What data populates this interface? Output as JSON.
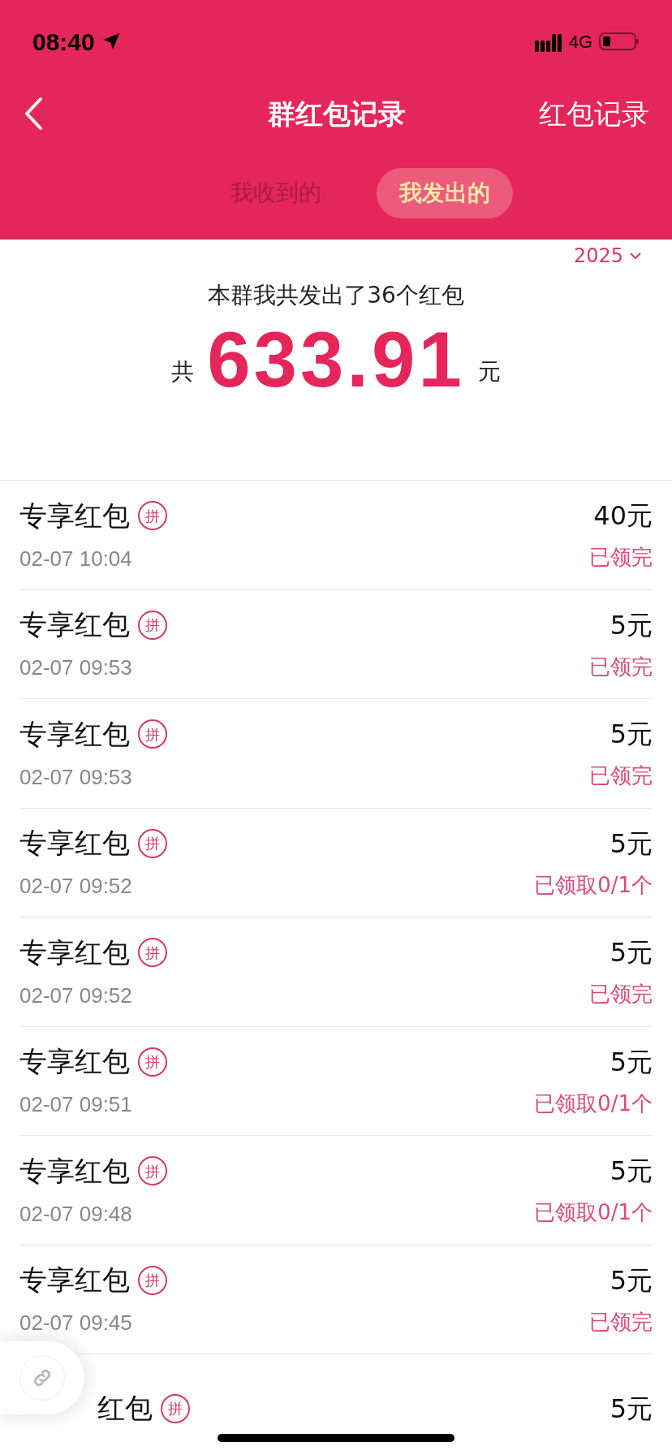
{
  "status_bar": {
    "time": "08:40",
    "network": "4G"
  },
  "nav": {
    "title": "群红包记录",
    "action": "红包记录"
  },
  "tabs": [
    {
      "label": "我收到的",
      "selected": false
    },
    {
      "label": "我发出的",
      "selected": true
    }
  ],
  "year": "2025",
  "summary": {
    "text": "本群我共发出了36个红包",
    "prefix": "共",
    "amount": "633.91",
    "unit": "元"
  },
  "records": [
    {
      "title": "专享红包",
      "badge": "拼",
      "time": "02-07 10:04",
      "amount": "40元",
      "status": "已领完"
    },
    {
      "title": "专享红包",
      "badge": "拼",
      "time": "02-07 09:53",
      "amount": "5元",
      "status": "已领完"
    },
    {
      "title": "专享红包",
      "badge": "拼",
      "time": "02-07 09:53",
      "amount": "5元",
      "status": "已领完"
    },
    {
      "title": "专享红包",
      "badge": "拼",
      "time": "02-07 09:52",
      "amount": "5元",
      "status": "已领取0/1个"
    },
    {
      "title": "专享红包",
      "badge": "拼",
      "time": "02-07 09:52",
      "amount": "5元",
      "status": "已领完"
    },
    {
      "title": "专享红包",
      "badge": "拼",
      "time": "02-07 09:51",
      "amount": "5元",
      "status": "已领取0/1个"
    },
    {
      "title": "专享红包",
      "badge": "拼",
      "time": "02-07 09:48",
      "amount": "5元",
      "status": "已领取0/1个"
    },
    {
      "title": "专享红包",
      "badge": "拼",
      "time": "02-07 09:45",
      "amount": "5元",
      "status": "已领完"
    },
    {
      "kind": "partial",
      "title": "红包",
      "badge": "拼",
      "amount": "5元"
    }
  ]
}
